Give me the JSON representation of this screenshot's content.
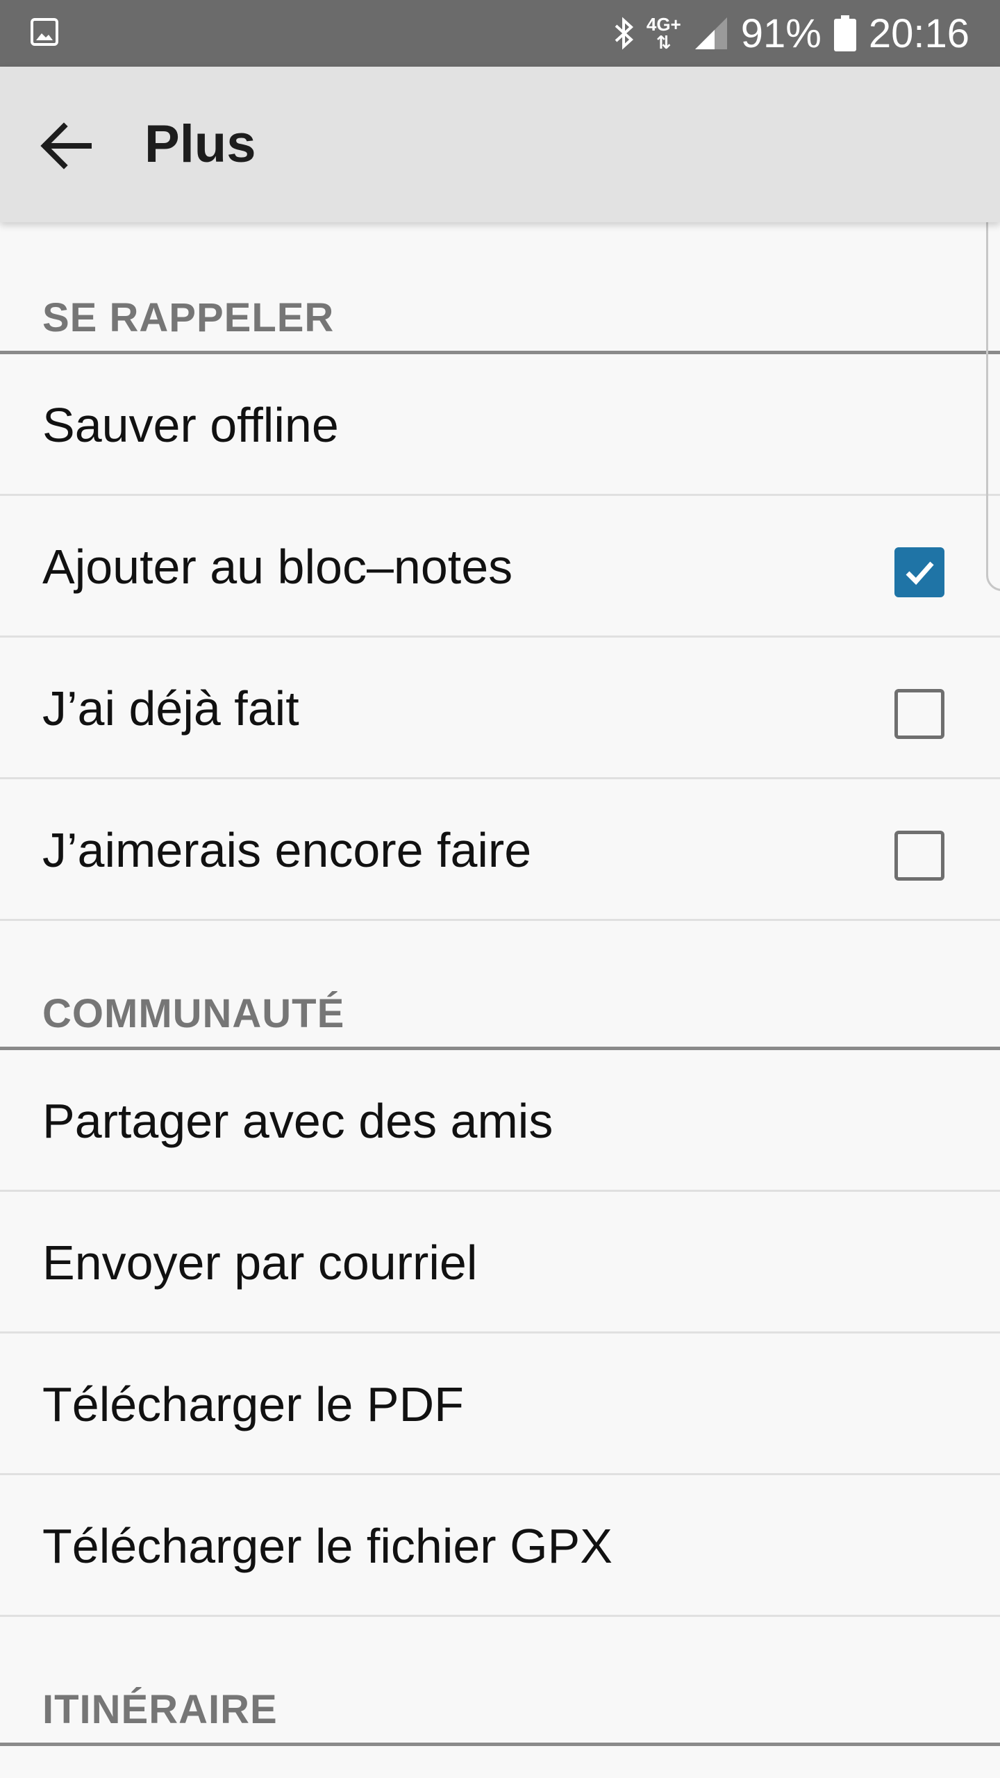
{
  "status_bar": {
    "icons": [
      "gallery-icon",
      "bluetooth-icon",
      "network-4g-icon",
      "signal-icon",
      "battery-icon"
    ],
    "network": "4G+",
    "battery": "91%",
    "time": "20:16"
  },
  "app_bar": {
    "title": "Plus",
    "back_icon": "arrow-back-icon"
  },
  "sections": {
    "remember": {
      "header": "SE RAPPELER",
      "items": [
        {
          "label": "Sauver offline"
        },
        {
          "label": "Ajouter au bloc–notes",
          "checked": true
        },
        {
          "label": "J’ai déjà fait",
          "checked": false
        },
        {
          "label": "J’aimerais encore faire",
          "checked": false
        }
      ]
    },
    "community": {
      "header": "COMMUNAUTÉ",
      "items": [
        {
          "label": "Partager avec des amis"
        },
        {
          "label": "Envoyer par courriel"
        },
        {
          "label": "Télécharger le PDF"
        },
        {
          "label": "Télécharger le fichier GPX"
        }
      ]
    },
    "route": {
      "header": "ITINÉRAIRE"
    }
  },
  "colors": {
    "status_bar": "#6b6b6b",
    "app_bar": "#e2e2e2",
    "background": "#f8f8f8",
    "accent_checkbox": "#1f74a6",
    "section_header_text": "#767676"
  }
}
